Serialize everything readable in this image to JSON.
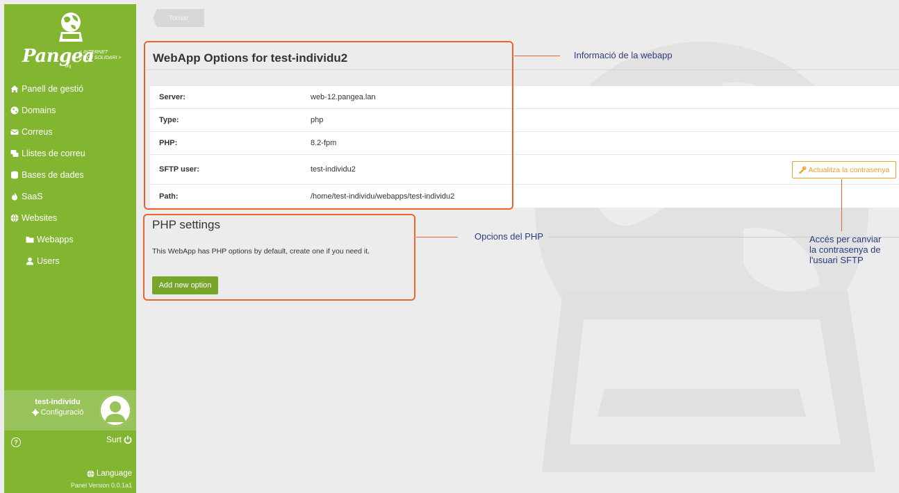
{
  "sidebar": {
    "brand": "Pangea",
    "tagline_1": "< INTERNET",
    "tagline_2": "ÈTIC I SOLIDARI >",
    "brand_org": ".org",
    "items": [
      {
        "label": "Panell de gestió",
        "icon": "home-icon"
      },
      {
        "label": "Domains",
        "icon": "globe-icon"
      },
      {
        "label": "Correus",
        "icon": "envelope-icon"
      },
      {
        "label": "Llistes de correu",
        "icon": "mailing-list-icon"
      },
      {
        "label": "Bases de dades",
        "icon": "database-icon"
      },
      {
        "label": "SaaS",
        "icon": "fire-icon"
      },
      {
        "label": "Websites",
        "icon": "globe-icon"
      },
      {
        "label": "Webapps",
        "icon": "folder-icon"
      },
      {
        "label": "Users",
        "icon": "user-icon"
      }
    ],
    "user": {
      "name": "test-individu",
      "config_label": "Configuració"
    },
    "help_label": "?",
    "logout_label": "Surt",
    "language_label": "Language",
    "version": "Panel Version 0.0.1a1"
  },
  "main": {
    "back_label": "Tornar",
    "title": "WebApp Options for test-individu2",
    "info_rows": [
      {
        "label": "Server:",
        "value": "web-12.pangea.lan"
      },
      {
        "label": "Type:",
        "value": "php"
      },
      {
        "label": "PHP:",
        "value": "8.2-fpm"
      },
      {
        "label": "SFTP user:",
        "value": "test-individu2"
      },
      {
        "label": "Path:",
        "value": "/home/test-individu/webapps/test-individu2"
      }
    ],
    "password_button": "Actualitza la contrasenya",
    "php_settings_title": "PHP settings",
    "php_settings_text": "This WebApp has PHP options by default, create one if you need it.",
    "add_option_button": "Add new option"
  },
  "annotations": {
    "webapp_info": "Informació de la webapp",
    "php_options": "Opcions del PHP",
    "password_access_1": "Accés per canviar",
    "password_access_2": "la contrasenya de",
    "password_access_3": "l'usuari SFTP"
  },
  "colors": {
    "sidebar": "#82b631",
    "accent_orange": "#e8662b",
    "annotation_text": "#2c3b80",
    "warning_button": "#f0a12a",
    "primary_button": "#77a62a"
  }
}
